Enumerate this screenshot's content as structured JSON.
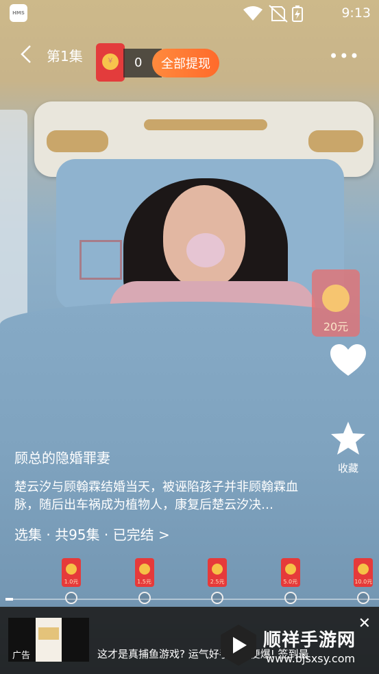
{
  "status_bar": {
    "app_badge": "HMS",
    "time": "9:13"
  },
  "top_bar": {
    "episode_title": "第1集",
    "reward_coin_glyph": "￥",
    "reward_count": "0",
    "withdraw_label": "全部提现",
    "more_glyph": "•••"
  },
  "side": {
    "red_packet_amount": "20元",
    "favorite_label": "收藏"
  },
  "video_info": {
    "title": "顾总的隐婚罪妻",
    "description": "楚云汐与顾翰霖结婚当天，被诬陷孩子并非顾翰霖血脉，随后出车祸成为植物人，康复后楚云汐决…",
    "episodes_label": "选集 · 共95集 · 已完结 >"
  },
  "timeline": {
    "progress": 0.02,
    "rewards": [
      {
        "label": "1.0元",
        "position": 0.18
      },
      {
        "label": "1.5元",
        "position": 0.38
      },
      {
        "label": "2.5元",
        "position": 0.58
      },
      {
        "label": "5.0元",
        "position": 0.78
      },
      {
        "label": "10.0元",
        "position": 0.98
      }
    ]
  },
  "ad": {
    "label": "广告",
    "text": "这才是真捕鱼游戏? 运气好手气随便爆! 签到最",
    "close_glyph": "✕"
  },
  "watermark": {
    "title": "顺祥手游网",
    "url": "www.bjsxsy.com"
  },
  "colors": {
    "accent_orange": "#ff7a33",
    "red_packet": "#e33c3c",
    "coin": "#f7c44c"
  }
}
